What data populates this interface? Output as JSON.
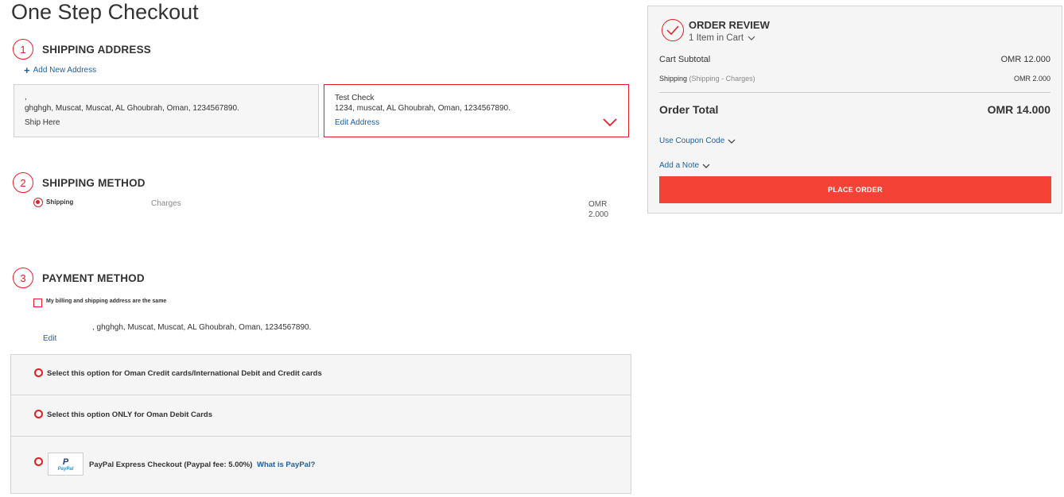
{
  "page": {
    "title": "One Step Checkout"
  },
  "steps": {
    "shipping_address": {
      "number": "1",
      "title": "SHIPPING ADDRESS"
    },
    "shipping_method": {
      "number": "2",
      "title": "SHIPPING METHOD"
    },
    "payment_method": {
      "number": "3",
      "title": "PAYMENT METHOD"
    }
  },
  "shipping_address": {
    "add_new_label": "Add New Address",
    "cards": [
      {
        "name": ",",
        "address": "ghghgh, Muscat, Muscat, AL Ghoubrah, Oman, 1234567890.",
        "action": "Ship Here",
        "selected": false
      },
      {
        "name": "Test Check",
        "address": "1234, muscat, AL Ghoubrah, Oman, 1234567890.",
        "action": "Edit Address",
        "selected": true
      }
    ]
  },
  "shipping_method": {
    "options": [
      {
        "name": "Shipping",
        "carrier": "Charges",
        "price_currency": "OMR",
        "price_value": "2.000",
        "selected": true
      }
    ]
  },
  "payment_method": {
    "same_address_label": "My billing and shipping address are the same",
    "same_address_checked": false,
    "billing_address": ", ghghgh, Muscat, Muscat, AL Ghoubrah, Oman, 1234567890.",
    "edit_label": "Edit",
    "options": [
      {
        "label": "Select this option for Oman Credit cards/International Debit and Credit cards",
        "selected": false
      },
      {
        "label": "Select this option ONLY for Oman Debit Cards",
        "selected": false
      },
      {
        "label": "PayPal Express Checkout (Paypal fee: 5.00%)",
        "link": "What is PayPal?",
        "logo_text": "P",
        "logo_word": "PayPal",
        "selected": false
      }
    ]
  },
  "order_review": {
    "title": "ORDER REVIEW",
    "items_count": "1 Item in Cart",
    "subtotal_label": "Cart Subtotal",
    "subtotal_value": "OMR 12.000",
    "shipping_label": "Shipping",
    "shipping_detail": "(Shipping - Charges)",
    "shipping_value": "OMR 2.000",
    "total_label": "Order Total",
    "total_value": "OMR 14.000",
    "coupon_label": "Use Coupon Code",
    "note_label": "Add a Note",
    "place_order_label": "PLACE ORDER"
  },
  "colors": {
    "accent": "#e31e24",
    "link": "#1f5f9e",
    "button": "#f44336"
  }
}
